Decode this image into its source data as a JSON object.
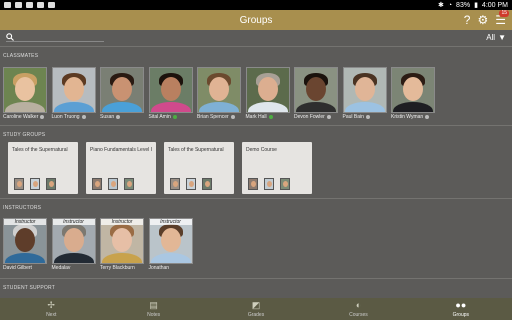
{
  "statusbar": {
    "battery": "83%",
    "time": "4:00 PM"
  },
  "appbar": {
    "title": "Groups",
    "help_icon": "?",
    "settings_icon": "gear",
    "menu_badge": "15"
  },
  "search": {
    "placeholder": "",
    "filter_label": "All"
  },
  "sections": {
    "classmates": "CLASSMATES",
    "study_groups": "STUDY GROUPS",
    "instructors": "INSTRUCTORS",
    "student_support": "STUDENT SUPPORT"
  },
  "classmates": [
    {
      "name": "Caroline Walker",
      "online": false,
      "skin": "#e9c2a0",
      "hair": "#c9a064",
      "shirt": "#b8b0a0",
      "bg": "#6d8450"
    },
    {
      "name": "Luon Truong",
      "online": false,
      "skin": "#e2b592",
      "hair": "#5c3a22",
      "shirt": "#5b9fd4",
      "bg": "#b7bcc0"
    },
    {
      "name": "Susan",
      "online": false,
      "skin": "#c99272",
      "hair": "#2a1a12",
      "shirt": "#4aa0d8",
      "bg": "#7a7f74"
    },
    {
      "name": "Sital Amin",
      "online": true,
      "skin": "#b98060",
      "hair": "#1c120c",
      "shirt": "#d04a8c",
      "bg": "#6b7d66"
    },
    {
      "name": "Brian Spencer",
      "online": false,
      "skin": "#e0b394",
      "hair": "#6b4a2e",
      "shirt": "#7fb0d4",
      "bg": "#7f8c67"
    },
    {
      "name": "Mark Hall",
      "online": true,
      "skin": "#dcae90",
      "hair": "#a8a096",
      "shirt": "#dfe6ec",
      "bg": "#5c6b4c"
    },
    {
      "name": "Devon Fowler",
      "online": false,
      "skin": "#6a4530",
      "hair": "#1a120c",
      "shirt": "#2e2e2e",
      "bg": "#8a9282"
    },
    {
      "name": "Paul Bain",
      "online": false,
      "skin": "#e0b597",
      "hair": "#4a3322",
      "shirt": "#9cc2e2",
      "bg": "#b0b8b4"
    },
    {
      "name": "Kristin Wyman",
      "online": false,
      "skin": "#e4ba9a",
      "hair": "#2c1c14",
      "shirt": "#1e1e22",
      "bg": "#7c8575"
    }
  ],
  "study_groups": [
    {
      "title": "Tales of the Supernatural",
      "thumbs": 3
    },
    {
      "title": "Piano Fundamentals Level I",
      "thumbs": 3
    },
    {
      "title": "Tales of the Supernatural",
      "thumbs": 3
    },
    {
      "title": "Demo Course",
      "thumbs": 3
    }
  ],
  "instructors": [
    {
      "name": "David Gilbert",
      "tag": "Instructor",
      "skin": "#5e3d2a",
      "hair": "#cfcfcf",
      "shirt": "#2f6a9a",
      "bg": "#8a9499"
    },
    {
      "name": "Medalav",
      "tag": "Instructor",
      "skin": "#d9ac8e",
      "hair": "#7c7870",
      "shirt": "#222a34",
      "bg": "#a3aab0"
    },
    {
      "name": "Terry Blackburn",
      "tag": "Instructor",
      "skin": "#e6bfa6",
      "hair": "#9a6c44",
      "shirt": "#c8a24c",
      "bg": "#c0b6a4"
    },
    {
      "name": "Jonathan",
      "tag": "Instructor",
      "skin": "#e2b796",
      "hair": "#5a3e2a",
      "shirt": "#aac7e2",
      "bg": "#bac4ca"
    }
  ],
  "bottom_nav": [
    {
      "label": "Next",
      "icon": "✢"
    },
    {
      "label": "Notes",
      "icon": "▤"
    },
    {
      "label": "Grades",
      "icon": "◩"
    },
    {
      "label": "Courses",
      "icon": "◐"
    },
    {
      "label": "Groups",
      "icon": "●●",
      "active": true
    }
  ]
}
